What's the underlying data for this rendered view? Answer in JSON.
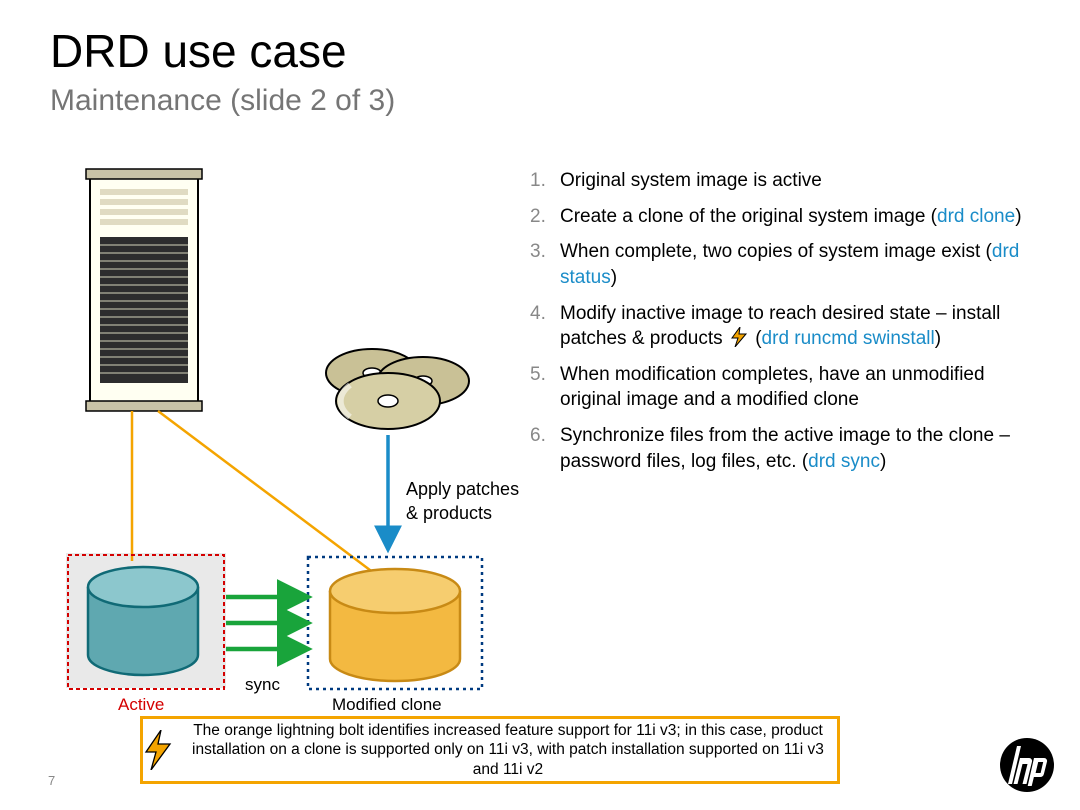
{
  "title": "DRD use case",
  "subtitle": "Maintenance (slide 2 of 3)",
  "steps": [
    {
      "text": "Original system image is active"
    },
    {
      "pre": "Create a clone of the original system image (",
      "cmd": "drd clone",
      "post": ")"
    },
    {
      "pre": "When complete, two copies of system image exist (",
      "cmd": "drd status",
      "post": ")"
    },
    {
      "pre": "Modify inactive image to reach desired state – install patches & products ",
      "bolt": true,
      "mid": " (",
      "cmd": "drd runcmd swinstall",
      "post": ")"
    },
    {
      "text": "When modification completes, have an unmodified original image and a modified clone"
    },
    {
      "pre": "Synchronize files from the active image to the clone – password files, log files, etc. (",
      "cmd": "drd sync",
      "post": ")"
    }
  ],
  "labels": {
    "apply_line1": "Apply patches",
    "apply_line2": "& products",
    "active": "Active",
    "modified": "Modified clone",
    "sync": "sync"
  },
  "note": "The orange lightning bolt identifies increased feature support for 11i v3; in this case, product installation on a clone is supported only on 11i v3, with patch installation supported on 11i v3 and 11i v2",
  "page_number": "7",
  "logo": "hp",
  "colors": {
    "accent_orange": "#f4a400",
    "cmd_blue": "#1a8cc8",
    "active_red": "#d40000",
    "sync_green": "#19a43b"
  }
}
